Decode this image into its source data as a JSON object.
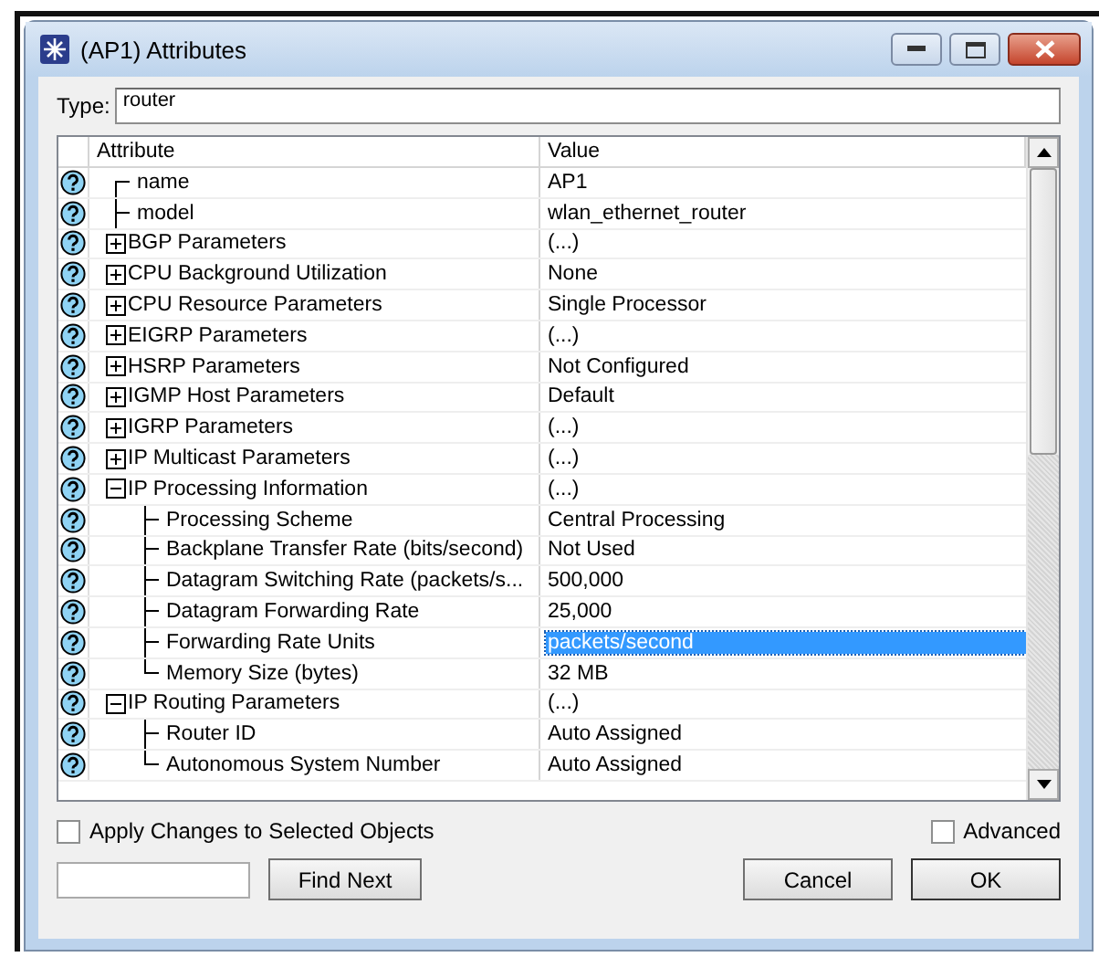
{
  "window": {
    "title": "(AP1) Attributes"
  },
  "type_field": {
    "label": "Type:",
    "value": "router"
  },
  "table": {
    "columns": [
      "Attribute",
      "Value"
    ],
    "rows": [
      {
        "attribute": "name",
        "value": "AP1",
        "selected": false
      },
      {
        "attribute": "model",
        "value": "wlan_ethernet_router",
        "selected": false
      },
      {
        "attribute": "BGP Parameters",
        "value": "(...)",
        "selected": false,
        "expanded": false,
        "children": []
      },
      {
        "attribute": "CPU Background Utilization",
        "value": "None",
        "selected": false,
        "expanded": false,
        "children": []
      },
      {
        "attribute": "CPU Resource Parameters",
        "value": "Single Processor",
        "selected": false,
        "expanded": false,
        "children": []
      },
      {
        "attribute": "EIGRP Parameters",
        "value": "(...)",
        "selected": false,
        "expanded": false,
        "children": []
      },
      {
        "attribute": "HSRP Parameters",
        "value": "Not Configured",
        "selected": false,
        "expanded": false,
        "children": []
      },
      {
        "attribute": "IGMP Host Parameters",
        "value": "Default",
        "selected": false,
        "expanded": false,
        "children": []
      },
      {
        "attribute": "IGRP Parameters",
        "value": "(...)",
        "selected": false,
        "expanded": false,
        "children": []
      },
      {
        "attribute": "IP Multicast Parameters",
        "value": "(...)",
        "selected": false,
        "expanded": false,
        "children": []
      },
      {
        "attribute": "IP Processing Information",
        "value": "(...)",
        "selected": false,
        "expanded": true,
        "children": [
          {
            "attribute": "Processing Scheme",
            "value": "Central Processing",
            "selected": false
          },
          {
            "attribute": "Backplane Transfer Rate (bits/second)",
            "value": "Not Used",
            "selected": false
          },
          {
            "attribute": "Datagram Switching Rate (packets/s...",
            "value": "500,000",
            "selected": false
          },
          {
            "attribute": "Datagram Forwarding Rate",
            "value": "25,000",
            "selected": false
          },
          {
            "attribute": "Forwarding Rate Units",
            "value": "packets/second",
            "selected": true
          },
          {
            "attribute": "Memory Size (bytes)",
            "value": "32 MB",
            "selected": false
          }
        ]
      },
      {
        "attribute": "IP Routing Parameters",
        "value": "(...)",
        "selected": false,
        "expanded": true,
        "children": [
          {
            "attribute": "Router ID",
            "value": "Auto Assigned",
            "selected": false
          },
          {
            "attribute": "Autonomous System Number",
            "value": "Auto Assigned",
            "selected": false
          }
        ]
      }
    ]
  },
  "options": [
    {
      "label": "Apply Changes to Selected Objects",
      "checked": false
    },
    {
      "label": "Advanced",
      "checked": false
    }
  ],
  "buttons": [
    "Find Next",
    "Cancel",
    "OK"
  ]
}
